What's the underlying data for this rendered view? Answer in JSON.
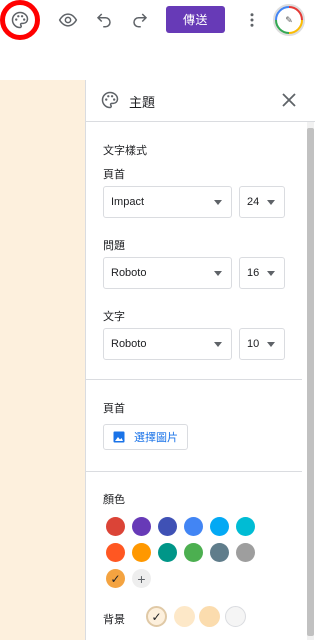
{
  "toolbar": {
    "send_label": "傳送",
    "icons": [
      "palette-icon",
      "eye-icon",
      "undo-icon",
      "redo-icon",
      "more-vert-icon"
    ],
    "accent_color": "#673ab7",
    "highlight_color": "#ff0000"
  },
  "theme_panel": {
    "title": "主題",
    "text_style": {
      "section_label": "文字樣式",
      "header": {
        "label": "頁首",
        "font": "Impact",
        "size": "24"
      },
      "question": {
        "label": "問題",
        "font": "Roboto",
        "size": "16"
      },
      "text": {
        "label": "文字",
        "font": "Roboto",
        "size": "10"
      }
    },
    "header_image": {
      "section_label": "頁首",
      "button_label": "選擇圖片"
    },
    "colors": {
      "section_label": "顏色",
      "swatches": [
        "#db4437",
        "#673ab7",
        "#3f51b5",
        "#4285f4",
        "#03a9f4",
        "#00bcd4",
        "#ff5722",
        "#ff9800",
        "#009688",
        "#4caf50",
        "#607d8b",
        "#9e9e9e",
        "#f4a340"
      ],
      "selected": "#f4a340"
    },
    "background": {
      "label": "背景",
      "swatches": [
        "#fdf0dd",
        "#fde8c8",
        "#fbdcae",
        "#f5f5f5"
      ],
      "selected": "#fdf0dd"
    }
  },
  "canvas_color": "#fdf0dd"
}
